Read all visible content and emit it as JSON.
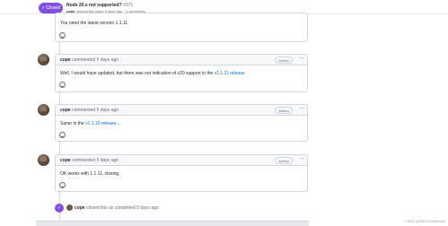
{
  "header": {
    "state_label": "Closed",
    "title": "Node 20.x not supported?",
    "number": "#371",
    "meta_author": "cope",
    "meta_text": "opened this issue 5 days ago · 4 comments"
  },
  "comments": [
    {
      "body": "You need the latest version 1.1.11"
    },
    {
      "author": "cope",
      "action": "commented 5 days ago",
      "badge": "Author",
      "body_text": "Well, I would have updated, but there was not indication of v20 support in the",
      "body_link": "v1.1.11 release.",
      "body_suffix": ""
    },
    {
      "author": "cope",
      "action": "commented 5 days ago",
      "badge": "Author",
      "body_text": "Same in the",
      "body_link": "v1.1.10 release",
      "body_suffix": "..."
    },
    {
      "author": "cope",
      "action": "commented 5 days ago",
      "badge": "Author",
      "body_text": "OK works with 1.1.11, closing."
    }
  ],
  "closed_event": {
    "author": "cope",
    "text": "closed this as completed 5 days ago"
  },
  "watermark": "CSDN @WEIGUANDIAN"
}
